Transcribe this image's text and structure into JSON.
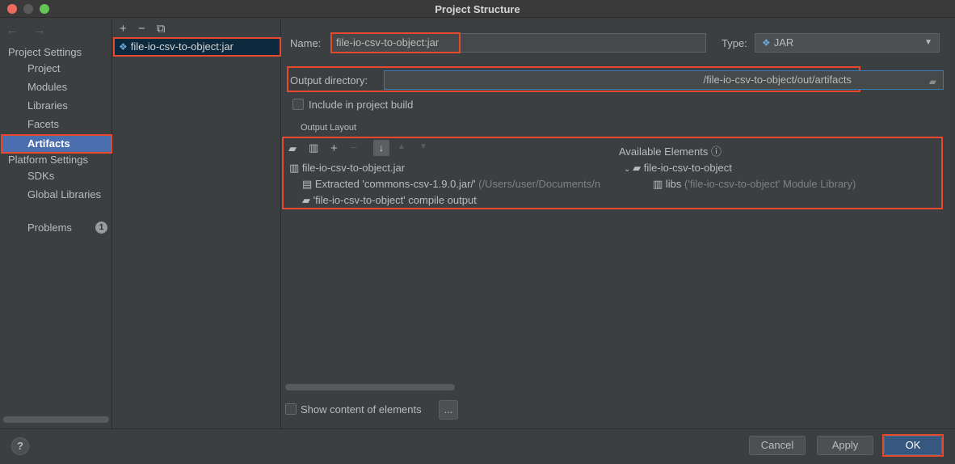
{
  "window": {
    "title": "Project Structure"
  },
  "nav": {
    "arrows": "← →",
    "project_settings": "Project Settings",
    "items1": [
      "Project",
      "Modules",
      "Libraries",
      "Facets",
      "Artifacts"
    ],
    "platform_settings": "Platform Settings",
    "items2": [
      "SDKs",
      "Global Libraries"
    ],
    "problems": "Problems",
    "problems_count": "1"
  },
  "artifacts_list": {
    "toolbar": [
      "+",
      "−",
      "⧉"
    ],
    "items": [
      "file-io-csv-to-object:jar"
    ]
  },
  "form": {
    "name_label": "Name:",
    "name_value": "file-io-csv-to-object:jar",
    "type_label": "Type:",
    "type_value": "JAR",
    "output_dir_label": "Output directory:",
    "output_dir_value": "/file-io-csv-to-object/out/artifacts",
    "include_label": "Include in project build",
    "output_layout_label": "Output Layout",
    "available_label": "Available Elements",
    "show_content_label": "Show content of elements",
    "ellipsis_label": "..."
  },
  "output_tree": [
    {
      "text": "file-io-csv-to-object.jar"
    },
    {
      "text": "Extracted 'commons-csv-1.9.0.jar/'",
      "dim": " (/Users/user/Documents/n"
    },
    {
      "text": "'file-io-csv-to-object' compile output"
    }
  ],
  "available_tree": [
    {
      "text": "file-io-csv-to-object"
    },
    {
      "text": "libs",
      "dim": " ('file-io-csv-to-object' Module Library)"
    }
  ],
  "buttons": {
    "help": "?",
    "cancel": "Cancel",
    "apply": "Apply",
    "ok": "OK"
  },
  "colors": {
    "accent": "#4b6eaf",
    "highlight_border": "#e8492d",
    "ok_button": "#365880"
  }
}
